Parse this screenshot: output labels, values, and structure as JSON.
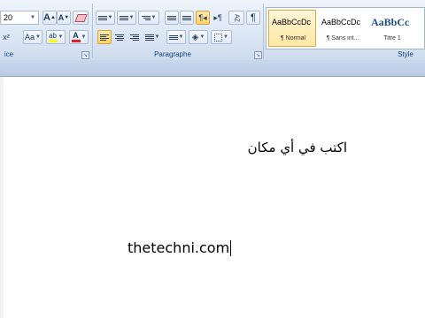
{
  "ribbon": {
    "font": {
      "size_value": "20",
      "grow_label": "A",
      "shrink_label": "A",
      "superscript_label": "x²",
      "change_case_label": "Aa",
      "group_label": "ice"
    },
    "paragraph": {
      "group_label": "Paragraphe",
      "pilcrow_label": "¶",
      "sort_label": "AZ",
      "highlight_color": "#ffff00",
      "font_color": "#e02020"
    },
    "styles": {
      "group_label": "Style",
      "items": [
        {
          "sample": "AaBbCcDc",
          "name": "¶ Normal",
          "selected": true
        },
        {
          "sample": "AaBbCcDc",
          "name": "¶ Sans int...",
          "selected": false
        },
        {
          "sample": "AaBbCc",
          "name": "Titre 1",
          "selected": false
        }
      ]
    }
  },
  "document": {
    "arabic_text": "اكتب في أي مكان",
    "domain_text": "thetechni.com"
  }
}
